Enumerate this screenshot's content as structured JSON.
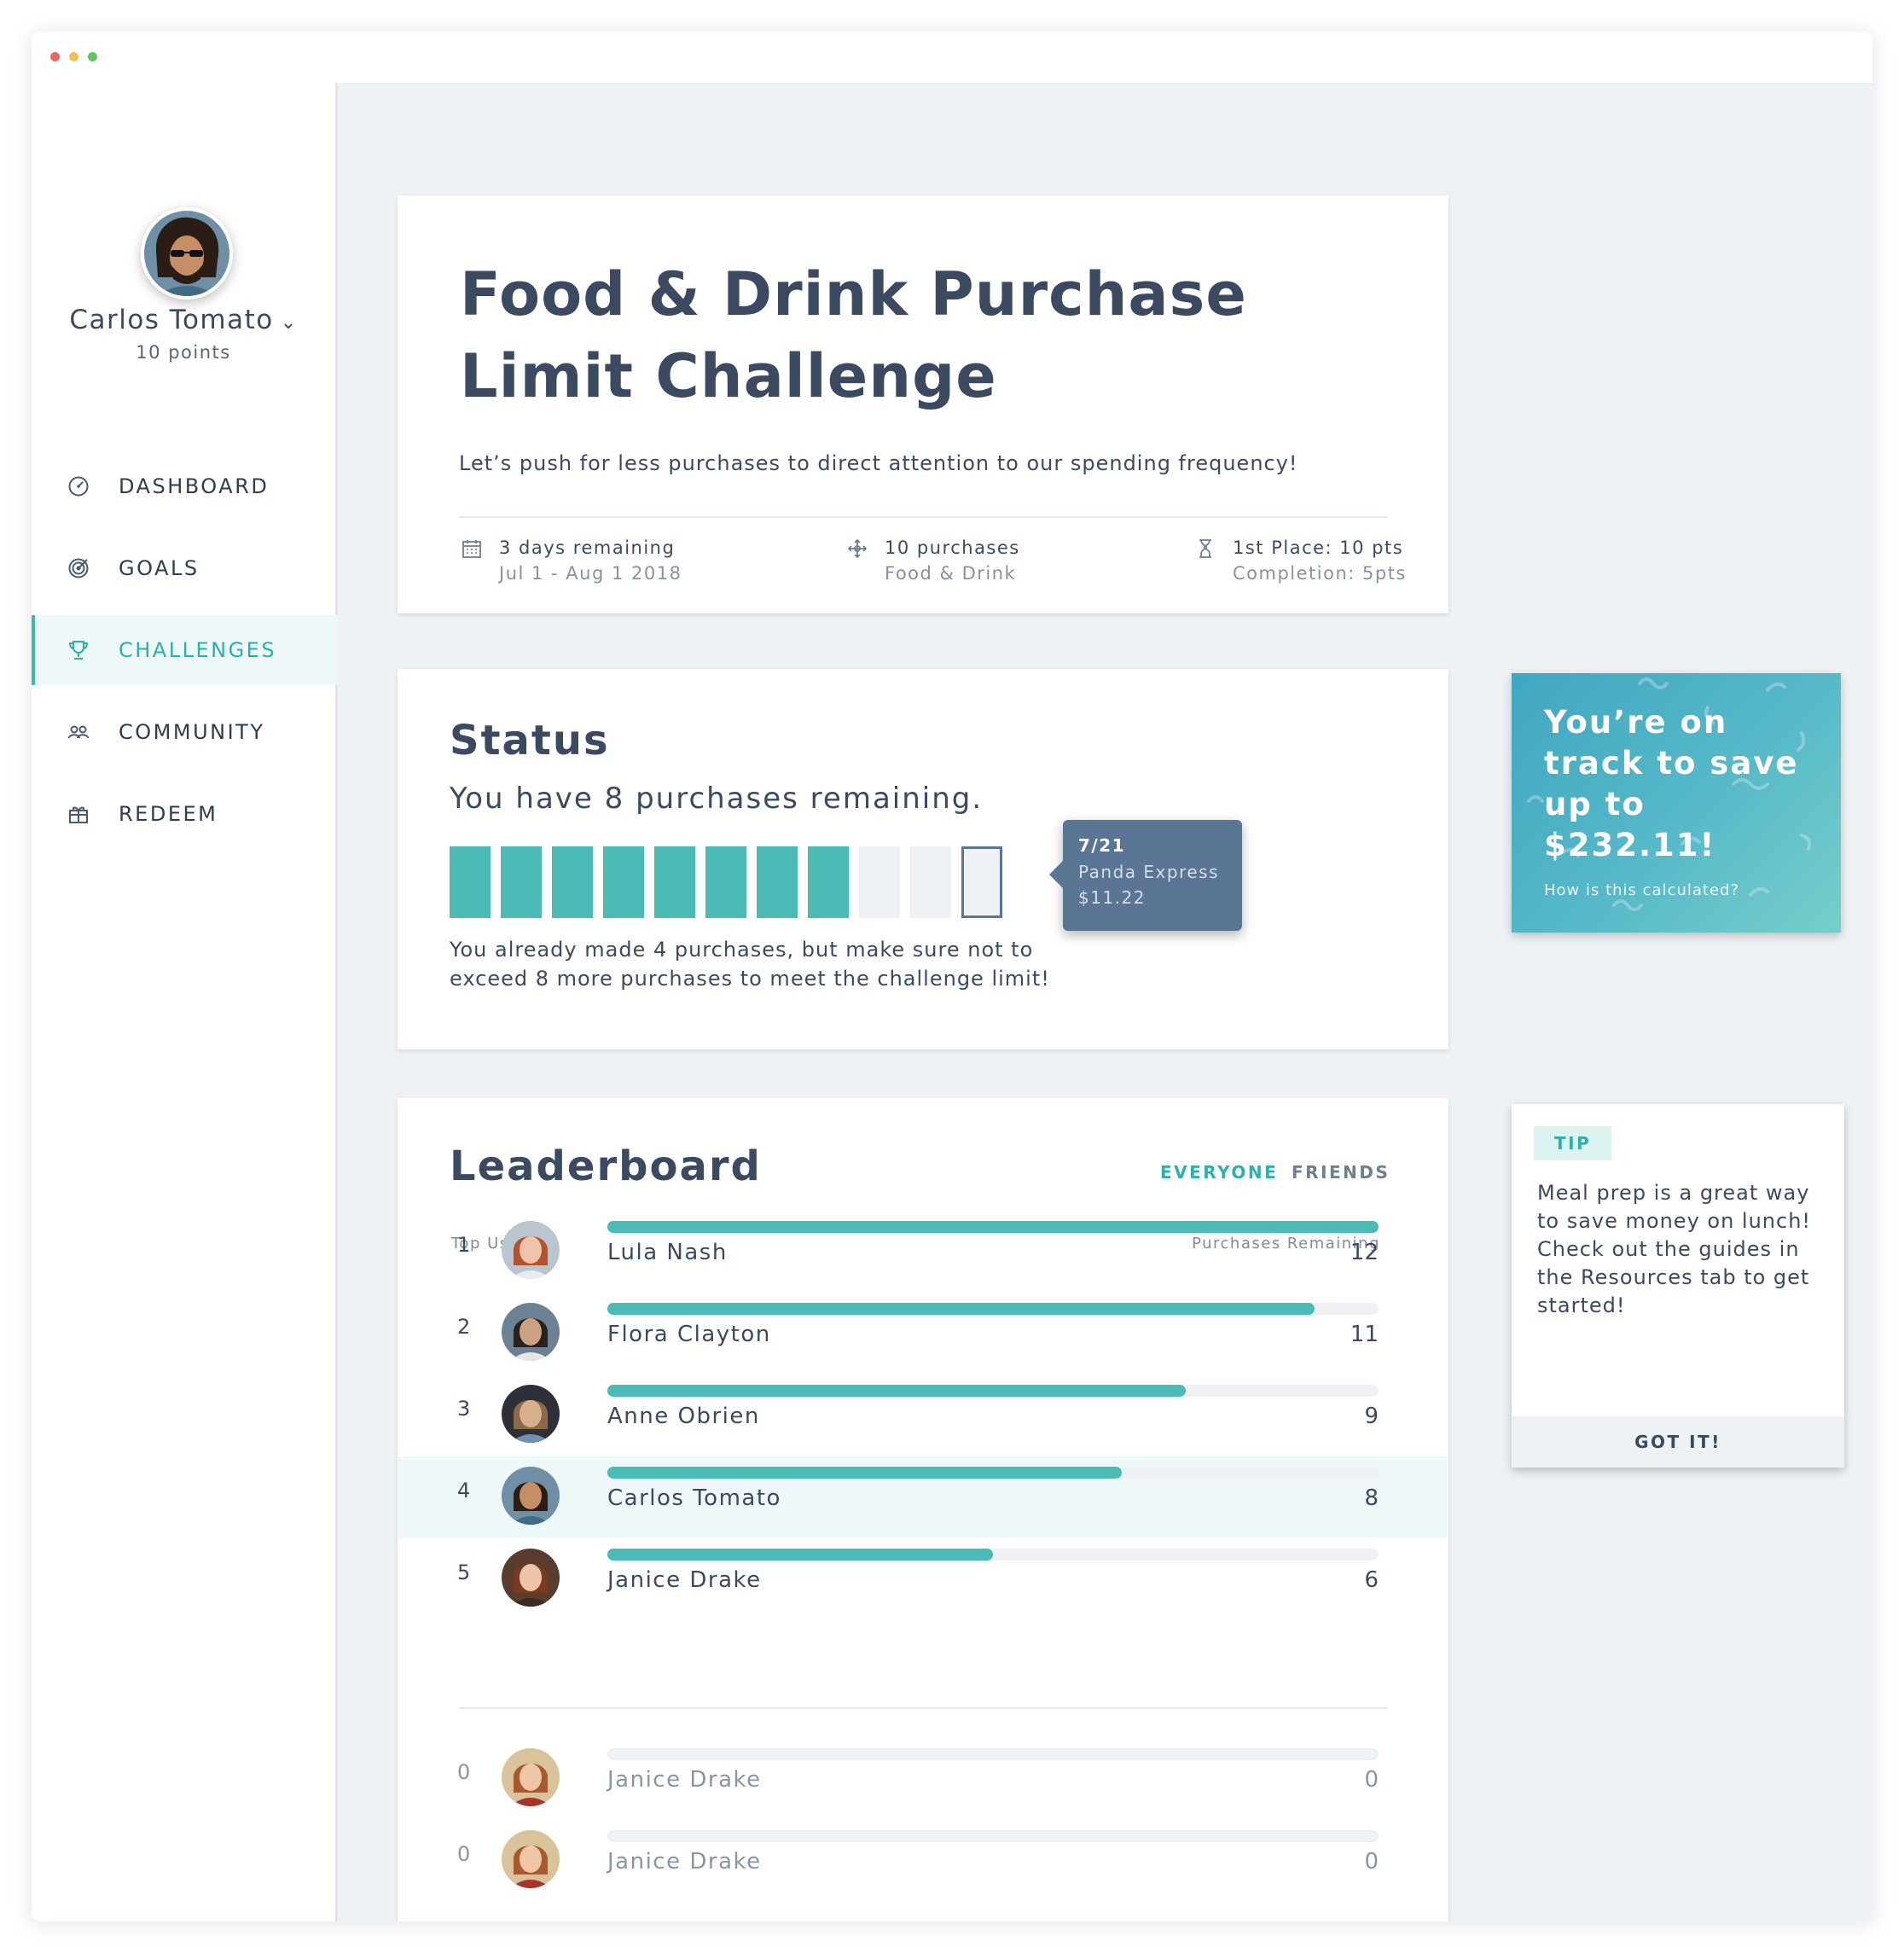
{
  "user": {
    "name": "Carlos Tomato",
    "points": "10 points"
  },
  "nav": [
    {
      "label": "DASHBOARD",
      "icon": "gauge-icon"
    },
    {
      "label": "GOALS",
      "icon": "target-icon"
    },
    {
      "label": "CHALLENGES",
      "icon": "trophy-icon",
      "active": true
    },
    {
      "label": "COMMUNITY",
      "icon": "people-icon"
    },
    {
      "label": "REDEEM",
      "icon": "gift-icon"
    }
  ],
  "challenge": {
    "title": "Food & Drink Purchase Limit Challenge",
    "description": "Let’s push for less purchases to direct attention to our spending frequency!",
    "meta": [
      {
        "icon": "calendar-icon",
        "line1": "3 days remaining",
        "line2": "Jul 1 - Aug 1 2018"
      },
      {
        "icon": "move-icon",
        "line1": "10 purchases",
        "line2": "Food & Drink"
      },
      {
        "icon": "hourglass-icon",
        "line1": "1st Place: 10 pts",
        "line2": "Completion: 5pts"
      }
    ]
  },
  "status": {
    "title": "Status",
    "subtitle": "You have 8 purchases remaining.",
    "progress": {
      "filled": 8,
      "total": 11
    },
    "tooltip": {
      "date": "7/21",
      "merchant": "Panda Express",
      "amount": "$11.22"
    },
    "note": "You already made 4 purchases, but make sure not to exceed 8 more purchases to meet the challenge limit!"
  },
  "leaderboard": {
    "title": "Leaderboard",
    "tabs": {
      "everyone": "EVERYONE",
      "friends": "FRIENDS"
    },
    "col_left": "Top Users",
    "col_right": "Purchases Remaining",
    "rows": [
      {
        "rank": "1",
        "name": "Lula Nash",
        "value": "12",
        "fill": 1.0
      },
      {
        "rank": "2",
        "name": "Flora Clayton",
        "value": "11",
        "fill": 0.917
      },
      {
        "rank": "3",
        "name": "Anne Obrien",
        "value": "9",
        "fill": 0.75
      },
      {
        "rank": "4",
        "name": "Carlos Tomato",
        "value": "8",
        "fill": 0.667
      },
      {
        "rank": "5",
        "name": "Janice Drake",
        "value": "6",
        "fill": 0.5
      }
    ],
    "extra_rows": [
      {
        "rank": "0",
        "name": "Janice Drake",
        "value": "0",
        "fill": 0
      },
      {
        "rank": "0",
        "name": "Janice Drake",
        "value": "0",
        "fill": 0
      }
    ]
  },
  "promo": {
    "text": "You’re on track to save up to $232.11!",
    "link": "How is this calculated?"
  },
  "tip": {
    "badge": "TIP",
    "text": "Meal prep is a great way to save money on lunch! Check out the guides in the Resources tab to get started!",
    "button": "GOT IT!"
  },
  "colors": {
    "accent": "#4cbab5",
    "navy": "#3b4a60",
    "tooltip": "#5b7595"
  }
}
